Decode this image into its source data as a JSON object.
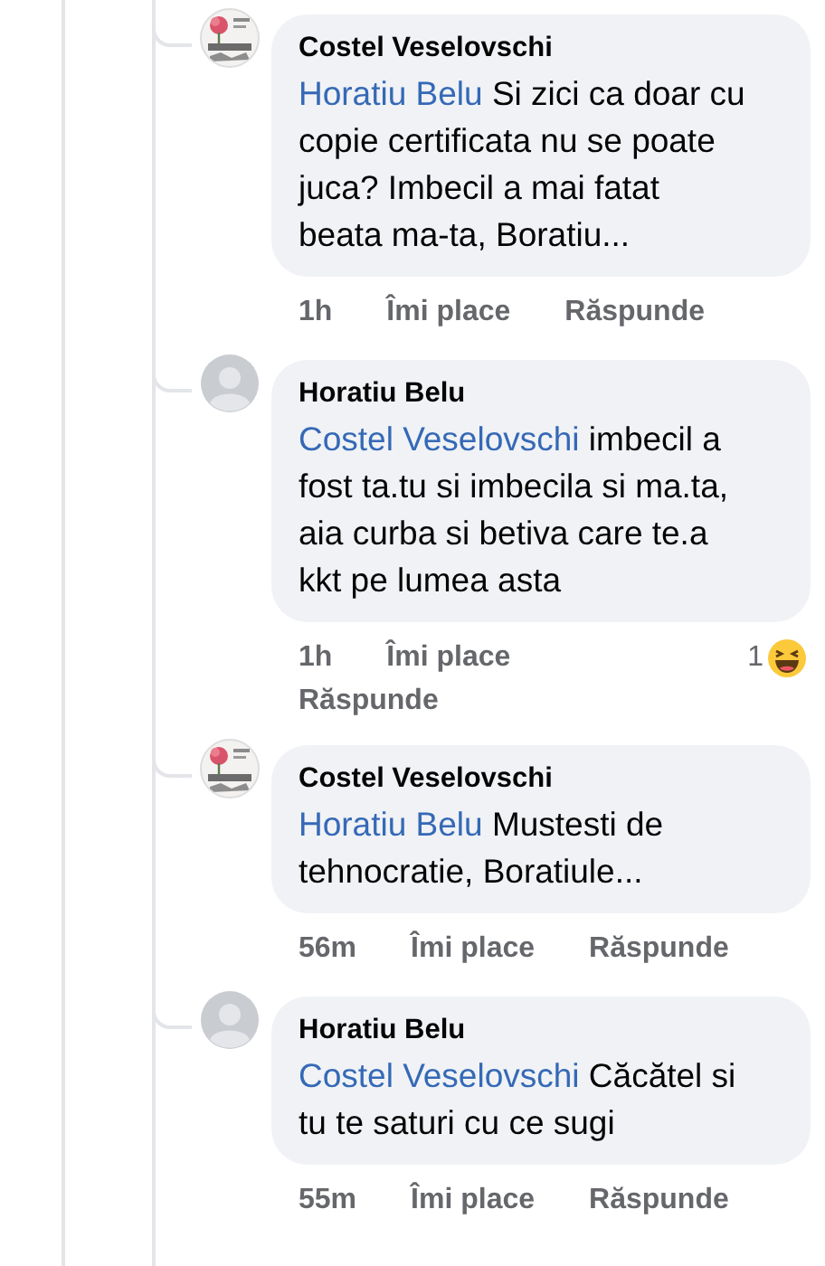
{
  "comments": [
    {
      "author": "Costel Veselovschi",
      "mention": "Horatiu Belu",
      "text": "Si zici ca doar cu copie certificata nu se poate juca? Imbecil a mai fatat beata ma-ta, Boratiu...",
      "time": "1h",
      "like": "Îmi place",
      "reply": "Răspunde"
    },
    {
      "avatar": {
        "kind": "default"
      },
      "author": "Horatiu Belu",
      "mention": "Costel Veselovschi",
      "text": "imbecil a fost ta.tu si imbecila si ma.ta, aia curba si betiva care te.a kkt pe lumea asta",
      "time": "1h",
      "like": "Îmi place",
      "reply": "Răspunde",
      "reaction": {
        "count": "1",
        "kind": "haha"
      }
    },
    {
      "author": "Costel Veselovschi",
      "mention": "Horatiu Belu",
      "text": "Mustesti de tehnocratie, Boratiule...",
      "time": "56m",
      "like": "Îmi place",
      "reply": "Răspunde"
    },
    {
      "avatar": {
        "kind": "default"
      },
      "author": "Horatiu Belu",
      "mention": "Costel Veselovschi",
      "text": "Căcătel si tu te saturi cu ce sugi",
      "time": "55m",
      "like": "Îmi place",
      "reply": "Răspunde"
    }
  ]
}
